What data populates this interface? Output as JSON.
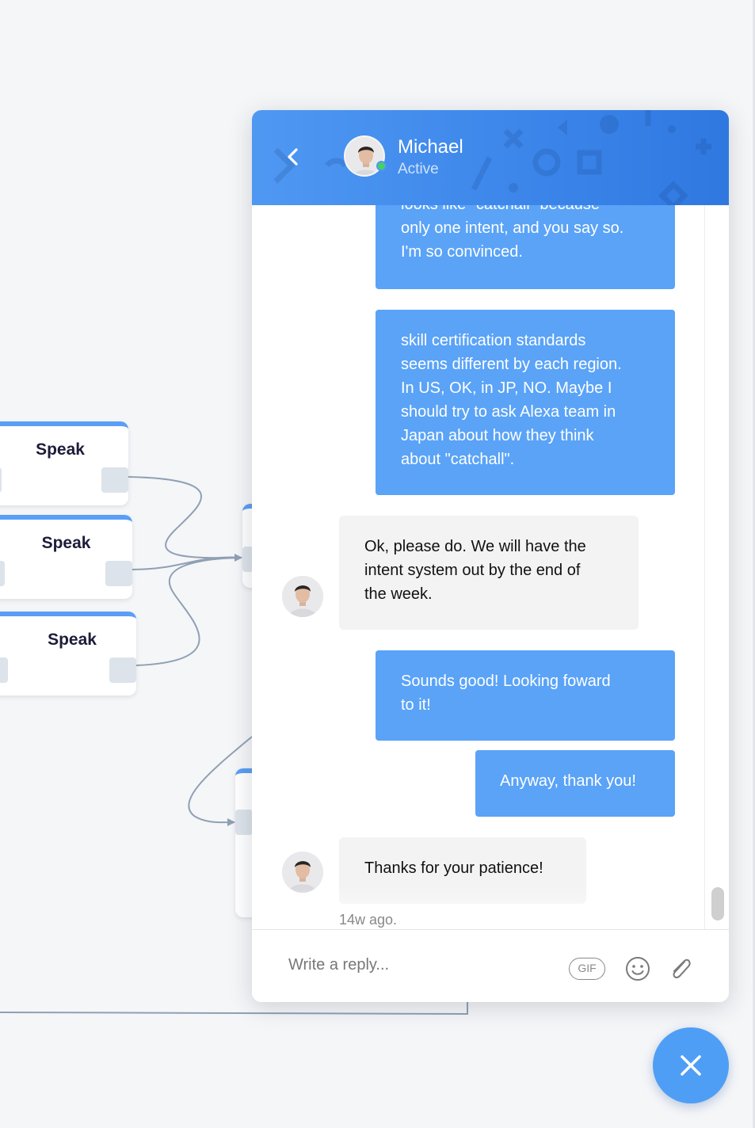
{
  "canvas": {
    "nodes": [
      {
        "title": "Speak"
      },
      {
        "title": "Speak"
      },
      {
        "title": "Speak"
      }
    ]
  },
  "chat": {
    "header": {
      "name": "Michael",
      "status": "Active"
    },
    "messages": [
      {
        "direction": "out",
        "lines": [
          "looks like \"catchall\" because",
          "only one intent, and you say so.",
          "I'm so convinced."
        ]
      },
      {
        "direction": "out",
        "lines": [
          "skill certification standards",
          "seems different by each region.",
          "In US, OK, in JP, NO. Maybe I",
          "should try to ask Alexa team in",
          "Japan about how they think",
          "about \"catchall\"."
        ]
      },
      {
        "direction": "in",
        "lines": [
          "Ok, please do. We will have the",
          "intent system out by the end of",
          "the week."
        ]
      },
      {
        "direction": "out",
        "lines": [
          "Sounds good! Looking foward",
          "to it!"
        ]
      },
      {
        "direction": "out",
        "lines": [
          "Anyway, thank you!"
        ]
      },
      {
        "direction": "in",
        "lines": [
          "Thanks for your patience!"
        ]
      }
    ],
    "timestamp": "14w ago.",
    "composer": {
      "placeholder": "Write a reply...",
      "gif_label": "GIF"
    }
  },
  "colors": {
    "accent": "#4f98f2",
    "bubble_out": "#5aa3f7",
    "bubble_in": "#f3f3f4",
    "online": "#46d160"
  },
  "icons": [
    "chevron-left-icon",
    "emoji-icon",
    "paperclip-icon",
    "close-icon"
  ]
}
